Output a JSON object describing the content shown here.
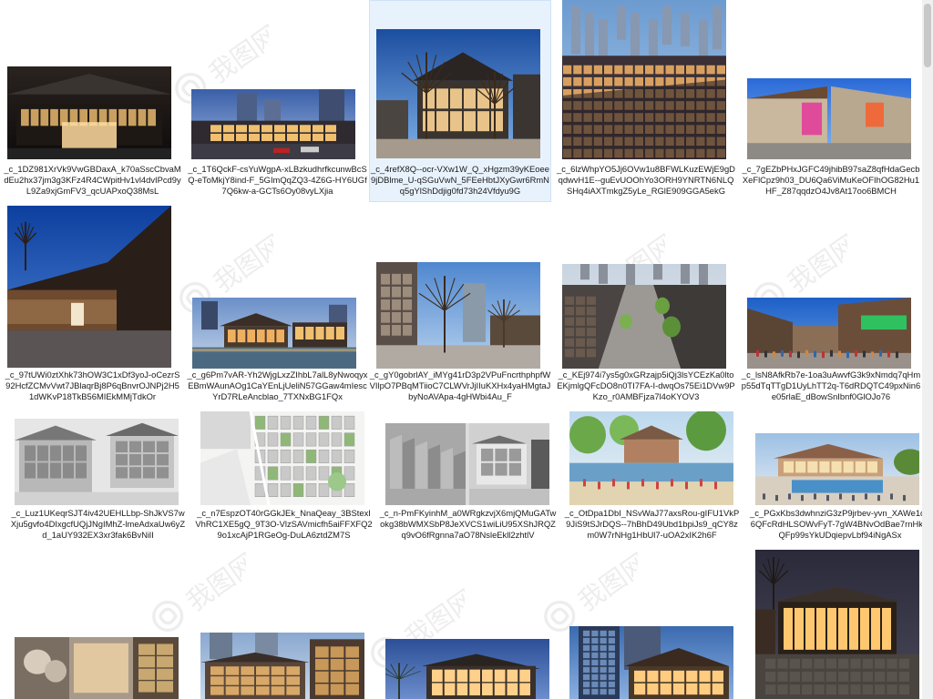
{
  "files": [
    {
      "caption": "_c_1DZ981XrVk9VwGBDaxA_k70aSscCbvaMdEu2hx37jm3g3KFz4R4CWpitHv1vl4dvIPcd9yL9Za9xjGmFV3_qcUAPxoQ38MsL",
      "scene": "hall",
      "selected": false
    },
    {
      "caption": "_c_1T6QckF-csYuWgpA-xLBzkudhrfkcunwBcSQ-eToMkjY8ind-F_5GImQqZQ3-4Z6G-HY6UGf7Q6kw-a-GCTs6Oy08vyLXjia",
      "scene": "dusk-street",
      "selected": false
    },
    {
      "caption": "_c_4refX8Q--ocr-VXw1W_Q_xHgzm39yKEoee9jDBlme_U-qSGuVwN_5FEeHbtJXyGwr6RmNq5gYlShDdjig0fd73h24Vfdyu9G",
      "scene": "plaza-tree",
      "selected": true
    },
    {
      "caption": "_c_6lzWhpYO5Jj6OVw1u8BFWLKuzEWjE9gDqdwvH1E--guEvUOOhYo3ORH9YNRTN6NLQSHq4iAXTmkgZ5yLe_RGlE909GGA5ekG",
      "scene": "aerial",
      "selected": false
    },
    {
      "caption": "_c_7gEZbPHxJGFC49jhibB97saZ8qfHdaGecbXeFlCpz9h03_DU6Qa6ViMuKeOFIhOG82Hu1HF_Z87qqdzO4Jv8At17oo6BMCH",
      "scene": "split",
      "selected": false
    },
    {
      "caption": "_c_97tUWi0ztXhk73hOW3C1xDf3yoJ-oCezrS92HcfZCMvVwt7JBlaqrBj8P6qBnvrOJNPj2H51dWKvP18TkB56MIEkMMjTdkOr",
      "scene": "portrait-roof",
      "selected": false
    },
    {
      "caption": "_c_g6Pm7vAR-Yh2WjgLxzZIhbL7alL8yNwoqyxEBmWAunAOg1CaYEnLjUeliN57GGaw4mIescYrD7RLeAncblao_7TXNxBG1FQx",
      "scene": "canal-dusk",
      "selected": false
    },
    {
      "caption": "_c_gY0gobrlAY_iMYg41rD3p2VPuFncrthphpfWVIlpO7PBqMTiioC7CLWVrJjIIuKXHx4yaHMgtaJbyNoAVApa-4gHWbi4Au_F",
      "scene": "tree-courtyard",
      "selected": false
    },
    {
      "caption": "_c_KEj974i7ys5g0xGRzajp5iQj3lsYCEzKa0ltoEKjmlgQFcDO8n0TI7FA-I-dwqOs75Ei1DVw9PKzo_r0AMBFjza7l4oKYOV3",
      "scene": "aerial-street",
      "selected": false
    },
    {
      "caption": "_c_lsN8AfkRb7e-1oa3uAwvfG3k9xNmdq7qHmp55dTqTTgD1UyLhTT2q-T6dRDQTC49pxNin6e05rlaE_dBowSnIbnf0GlOJo76",
      "scene": "crowd-street",
      "selected": false
    },
    {
      "caption": "_c_Luz1UKeqrSJT4iv42UEHLLbp-ShJkVS7wXju5gvfo4DIxgcfUQjJNgIMhZ-lmeAdxaUw6yZd_1aUY932EX3xr3fak6BvNilI",
      "scene": "gray-render",
      "selected": false
    },
    {
      "caption": "_c_n7EspzOT40rGGkJEk_NnaQeay_3BStexIVhRC1XE5gQ_9T3O-VlzSAVmicfh5aiFFXFQ29o1xcAjP1RGeOg-DuLA6ztdZM7S",
      "scene": "masterplan",
      "selected": false
    },
    {
      "caption": "_c_n-PmFKyinhM_a0WRgkzvjX6mjQMuGATwokg38bWMXSbP8JeXVCS1wiLiU95XShJRQZq9vO6fRgnna7aO78NsleEkll2zhtlV",
      "scene": "gray-model",
      "selected": false
    },
    {
      "caption": "_c_OtDpa1DbI_NSvWaJ77axsRou-gIFU1VkP9JiS9tSJrDQS--7hBhD49Ubd1bpiJs9_qCY8zm0W7rNHg1HbUl7-uOA2xIK2h6F",
      "scene": "watercolor-canal",
      "selected": false
    },
    {
      "caption": "_c_PGxKbs3dwhnziG3zP9jrbev-yvn_XAWe1oZ6QFcRdHLSOWvFyT-7gW4BNvOdBae7rnHkkfQFp99sYkUDqiepvLbf94iNgASx",
      "scene": "watercolor-pool",
      "selected": false
    },
    {
      "caption": "",
      "scene": "hall-night",
      "selected": false
    },
    {
      "caption": "",
      "scene": "mural",
      "selected": false
    },
    {
      "caption": "",
      "scene": "tower-street",
      "selected": false
    },
    {
      "caption": "",
      "scene": "glass-dusk",
      "selected": false
    },
    {
      "caption": "",
      "scene": "glass-tower",
      "selected": false
    }
  ],
  "watermark": {
    "icon": "watermark-logo-icon",
    "text": "我图网"
  },
  "colors": {
    "selection": "#e8f2fc",
    "selection_border": "#cfe3f7",
    "caption": "#1a1a1a"
  }
}
